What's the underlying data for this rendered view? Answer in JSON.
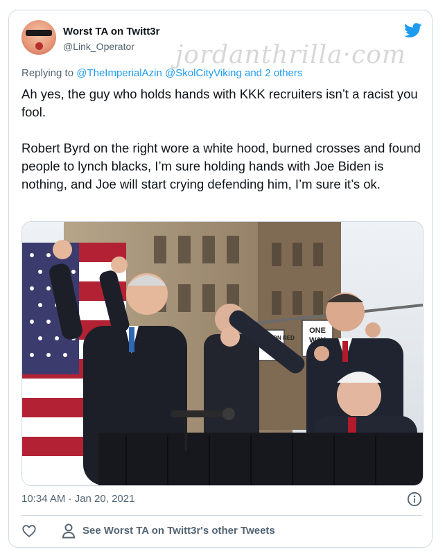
{
  "tweet": {
    "display_name": "Worst TA on Twitt3r",
    "handle": "@Link_Operator",
    "reply": {
      "prefix": "Replying to",
      "mention_1": "@TheImperialAzin",
      "mention_2": "@SkolCityViking",
      "suffix": "and 2 others"
    },
    "text_paragraph_1": "Ah yes, the guy who holds hands with KKK recruiters isn’t a racist you fool.",
    "text_paragraph_2": "Robert Byrd on the right wore a white hood, burned crosses and found people to lynch blacks, I’m sure holding hands with Joe Biden is nothing, and Joe will start crying defending him, I’m sure it’s ok.",
    "timestamp": "10:34 AM · Jan 20, 2021",
    "see_more": "See Worst TA on Twitt3r's other Tweets"
  },
  "watermark": "jordanthrilla·com",
  "photo": {
    "sign_1": "NO TURN ON RED",
    "sign_2_line_1": "ONE",
    "sign_2_line_2": "WAY"
  },
  "icons": {
    "bird": "twitter-bird-icon",
    "info": "info-icon",
    "heart": "heart-icon",
    "person": "person-icon"
  },
  "colors": {
    "brand_blue": "#1d9bf0",
    "secondary_text": "#536471",
    "border": "#cfd9de"
  }
}
